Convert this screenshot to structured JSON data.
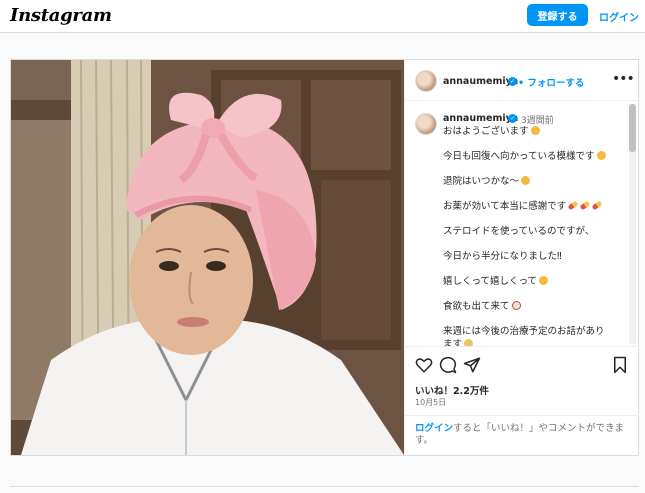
{
  "topbar": {
    "logo": "Instagram",
    "signup_label": "登録する",
    "login_label": "ログイン"
  },
  "post": {
    "header": {
      "username": "annaumemiya",
      "follow_label": "• フォローする"
    },
    "caption": {
      "username": "annaumemiya",
      "time_ago": "3週間前",
      "lines": [
        "おはようございます",
        "今日も回復へ向かっている模様です",
        "退院はいつかな〜",
        "お薬が効いて本当に感謝です",
        "ステロイドを使っているのですが、",
        "今日から半分になりました‼",
        "嬉しくって嬉しくって",
        "食欲も出て来て",
        "来週には今後の治療予定のお話があり",
        "ます"
      ]
    },
    "likes": "いいね！2.2万件",
    "date": "10月5日",
    "login_prompt": {
      "link": "ログイン",
      "text": "すると「いいね！」やコメントができます。"
    }
  },
  "icons": [
    "heart-icon",
    "comment-icon",
    "share-icon",
    "bookmark-icon",
    "verified-icon",
    "more-icon"
  ],
  "colors": {
    "accent": "#0095f6",
    "border": "#dbdbdb",
    "muted": "#737373"
  }
}
